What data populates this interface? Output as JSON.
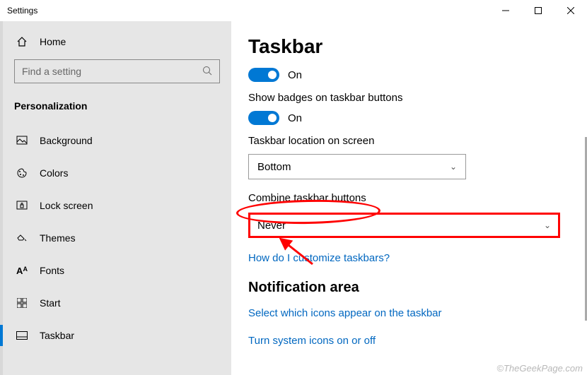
{
  "titlebar": {
    "title": "Settings"
  },
  "sidebar": {
    "home": "Home",
    "searchPlaceholder": "Find a setting",
    "category": "Personalization",
    "items": [
      {
        "label": "Background"
      },
      {
        "label": "Colors"
      },
      {
        "label": "Lock screen"
      },
      {
        "label": "Themes"
      },
      {
        "label": "Fonts"
      },
      {
        "label": "Start"
      },
      {
        "label": "Taskbar"
      }
    ]
  },
  "content": {
    "title": "Taskbar",
    "toggle1": "On",
    "badgesLabel": "Show badges on taskbar buttons",
    "toggle2": "On",
    "locationLabel": "Taskbar location on screen",
    "locationValue": "Bottom",
    "combineLabel": "Combine taskbar buttons",
    "combineValue": "Never",
    "customizeLink": "How do I customize taskbars?",
    "notifTitle": "Notification area",
    "notifLink1": "Select which icons appear on the taskbar",
    "notifLink2": "Turn system icons on or off"
  },
  "watermark": "©TheGeekPage.com"
}
